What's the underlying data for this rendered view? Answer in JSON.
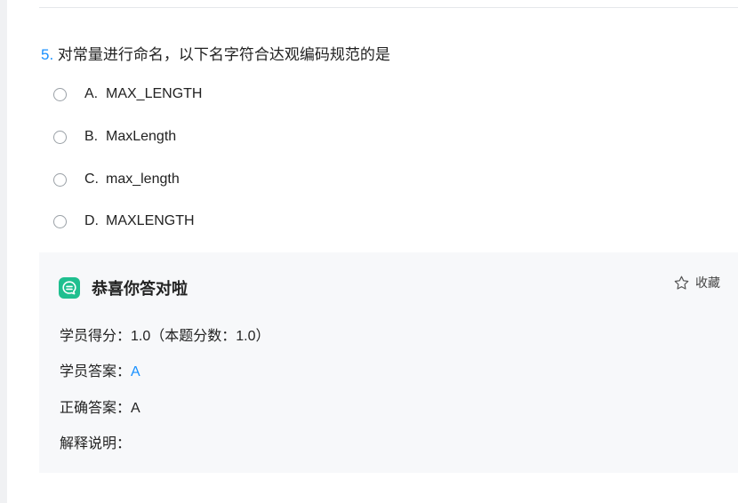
{
  "question": {
    "number": "5.",
    "text": "对常量进行命名，以下名字符合达观编码规范的是"
  },
  "options": [
    {
      "letter": "A.",
      "text": "MAX_LENGTH"
    },
    {
      "letter": "B.",
      "text": "MaxLength"
    },
    {
      "letter": "C.",
      "text": "max_length"
    },
    {
      "letter": "D.",
      "text": "MAXLENGTH"
    }
  ],
  "result": {
    "title": "恭喜你答对啦",
    "collect_label": "收藏",
    "score_label": "学员得分：",
    "score_value": "1.0（本题分数：1.0）",
    "student_answer_label": "学员答案：",
    "student_answer_value": "A",
    "correct_answer_label": "正确答案：",
    "correct_answer_value": "A",
    "explanation_label": "解释说明："
  },
  "colors": {
    "accent": "#1890ff",
    "success": "#1fbf8f",
    "panel": "#f7f8fa"
  },
  "icons": {
    "result": "chat-bubble-icon",
    "collect": "star-outline-icon",
    "option": "radio-unchecked-icon"
  }
}
